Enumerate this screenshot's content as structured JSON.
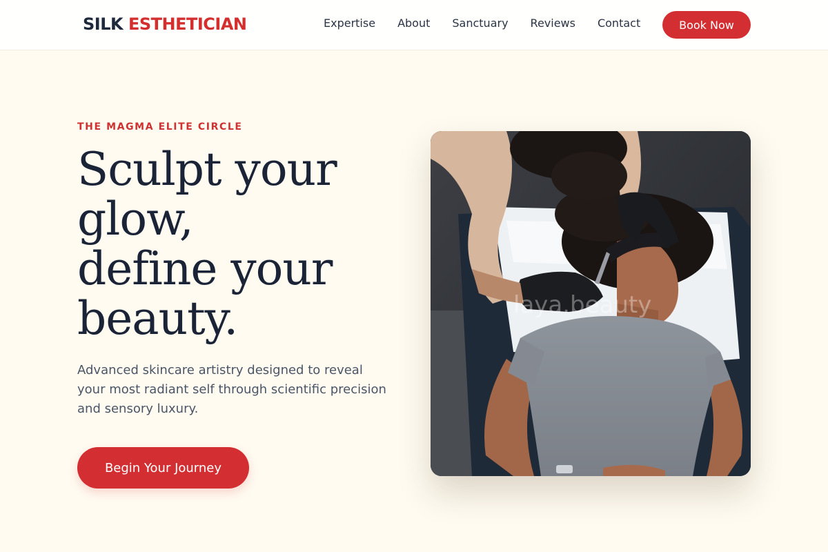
{
  "header": {
    "logo_part1": "SILK",
    "logo_part2": "ESTHETICIAN",
    "nav": [
      "Expertise",
      "About",
      "Sanctuary",
      "Reviews",
      "Contact"
    ],
    "book_label": "Book Now"
  },
  "hero": {
    "eyebrow": "THE MAGMA ELITE CIRCLE",
    "headline_lines": [
      "Sculpt your",
      "glow,",
      "define your",
      "beauty."
    ],
    "subtext": "Advanced skincare artistry designed to reveal your most radiant self through scientific precision and sensory luxury.",
    "cta_label": "Begin Your Journey"
  },
  "image": {
    "subject": "esthetician-treating-client-photo",
    "watermark": "laya.beauty"
  },
  "colors": {
    "accent": "#d32f32",
    "background": "#fffbf1",
    "text_dark": "#1b2437",
    "text_muted": "#4a5566"
  }
}
